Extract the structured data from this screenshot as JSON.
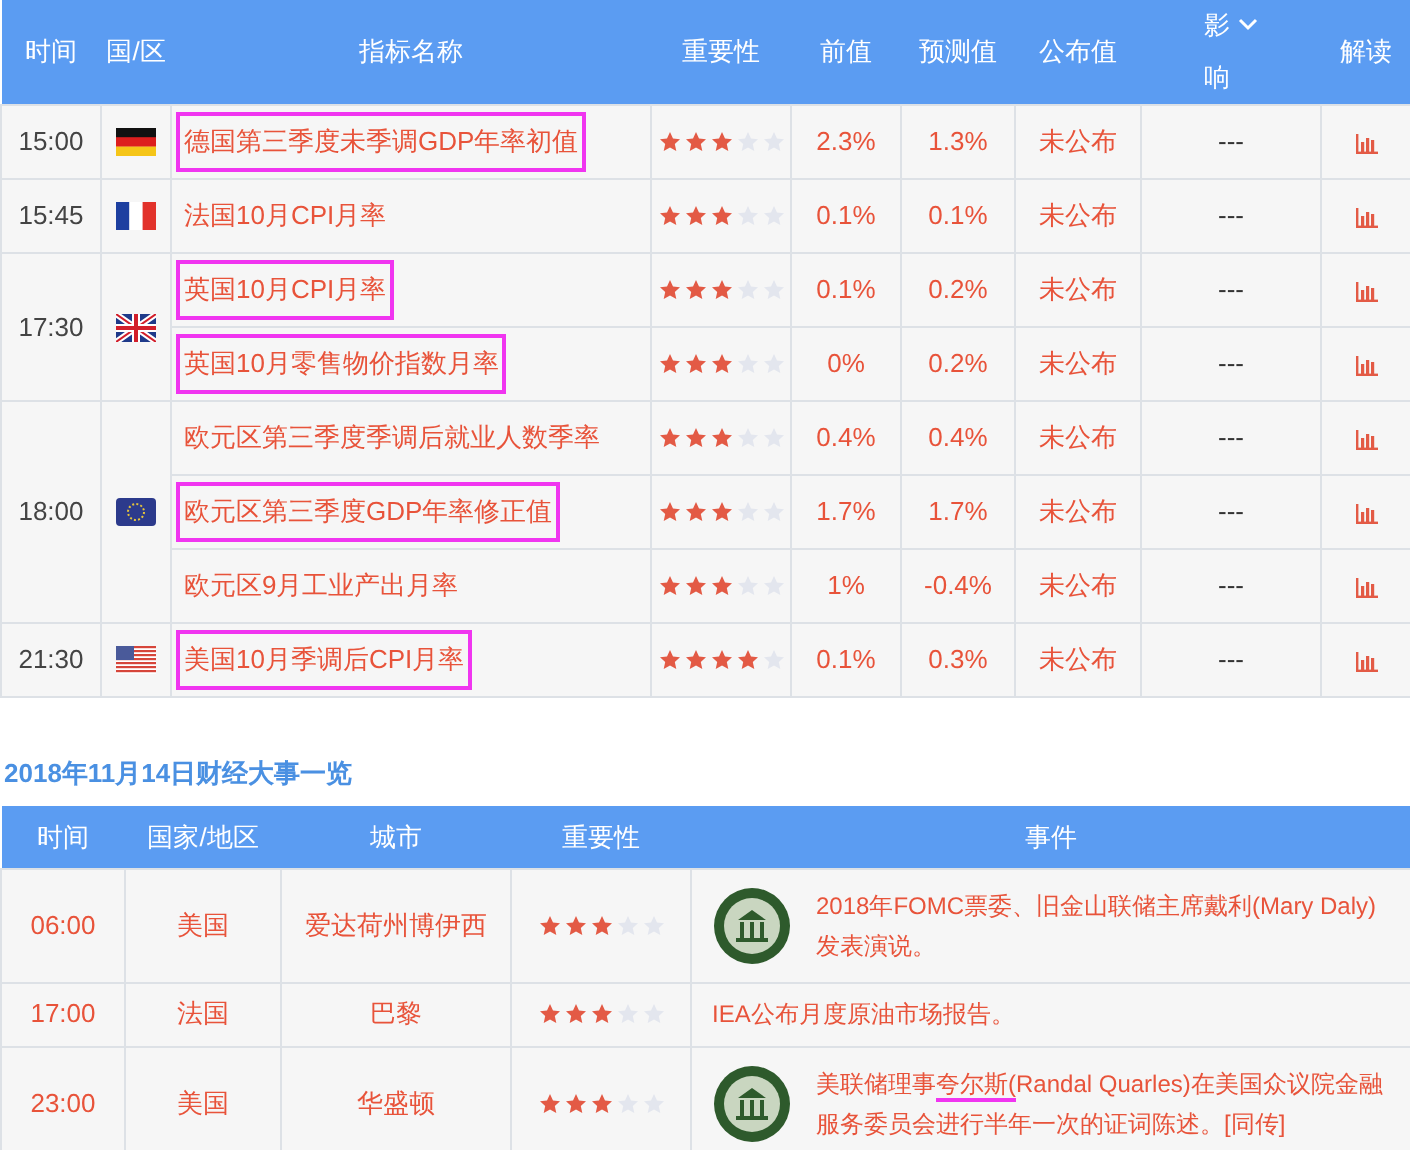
{
  "indicators_table": {
    "columns": [
      {
        "label": "时间"
      },
      {
        "label": "国/区"
      },
      {
        "label": "指标名称"
      },
      {
        "label": "重要性"
      },
      {
        "label": "前值"
      },
      {
        "label": "预测值"
      },
      {
        "label": "公布值"
      },
      {
        "label": "影响",
        "dropdown": true
      },
      {
        "label": "解读"
      }
    ],
    "groups": [
      {
        "time": "15:00",
        "flag": {
          "kind": "de"
        },
        "rows": [
          {
            "name": "德国第三季度未季调GDP年率初值",
            "highlighted": true,
            "stars": 3,
            "previous": "2.3%",
            "forecast": "1.3%",
            "actual": "未公布",
            "impact": "---"
          }
        ]
      },
      {
        "time": "15:45",
        "flag": {
          "kind": "fr"
        },
        "rows": [
          {
            "name": "法国10月CPI月率",
            "highlighted": false,
            "stars": 3,
            "previous": "0.1%",
            "forecast": "0.1%",
            "actual": "未公布",
            "impact": "---"
          }
        ]
      },
      {
        "time": "17:30",
        "flag": {
          "kind": "gb"
        },
        "rows": [
          {
            "name": "英国10月CPI月率",
            "highlighted": true,
            "stars": 3,
            "previous": "0.1%",
            "forecast": "0.2%",
            "actual": "未公布",
            "impact": "---"
          },
          {
            "name": "英国10月零售物价指数月率",
            "highlighted": true,
            "stars": 3,
            "previous": "0%",
            "forecast": "0.2%",
            "actual": "未公布",
            "impact": "---"
          }
        ]
      },
      {
        "time": "18:00",
        "flag": {
          "kind": "eu"
        },
        "rows": [
          {
            "name": "欧元区第三季度季调后就业人数季率",
            "highlighted": false,
            "stars": 3,
            "previous": "0.4%",
            "forecast": "0.4%",
            "actual": "未公布",
            "impact": "---"
          },
          {
            "name": "欧元区第三季度GDP年率修正值",
            "highlighted": true,
            "stars": 3,
            "previous": "1.7%",
            "forecast": "1.7%",
            "actual": "未公布",
            "impact": "---"
          },
          {
            "name": "欧元区9月工业产出月率",
            "highlighted": false,
            "stars": 3,
            "previous": "1%",
            "forecast": "-0.4%",
            "actual": "未公布",
            "impact": "---"
          }
        ]
      },
      {
        "time": "21:30",
        "flag": {
          "kind": "us"
        },
        "rows": [
          {
            "name": "美国10月季调后CPI月率",
            "highlighted": true,
            "stars": 4,
            "previous": "0.1%",
            "forecast": "0.3%",
            "actual": "未公布",
            "impact": "---"
          }
        ]
      }
    ]
  },
  "events_section": {
    "title": "2018年11月14日财经大事一览",
    "columns": [
      {
        "label": "时间"
      },
      {
        "label": "国家/地区"
      },
      {
        "label": "城市"
      },
      {
        "label": "重要性"
      },
      {
        "label": "事件"
      }
    ],
    "rows": [
      {
        "time": "06:00",
        "country": "美国",
        "city": "爱达荷州博伊西",
        "stars": 3,
        "seal": true,
        "event": [
          {
            "text": "2018年FOMC票委、旧金山联储主席戴利(Mary Daly)发表演说。",
            "underlined": false
          }
        ]
      },
      {
        "time": "17:00",
        "country": "法国",
        "city": "巴黎",
        "stars": 3,
        "seal": false,
        "event": [
          {
            "text": "IEA公布月度原油市场报告。",
            "underlined": false
          }
        ]
      },
      {
        "time": "23:00",
        "country": "美国",
        "city": "华盛顿",
        "stars": 3,
        "seal": true,
        "event": [
          {
            "text": "美联储理事",
            "underlined": false
          },
          {
            "text": "夸尔斯(",
            "underlined": true
          },
          {
            "text": "Randal Quarles)在美国众议院金融服务委员会进行半年一次的证词陈述。[同传]",
            "underlined": false
          }
        ]
      }
    ]
  }
}
